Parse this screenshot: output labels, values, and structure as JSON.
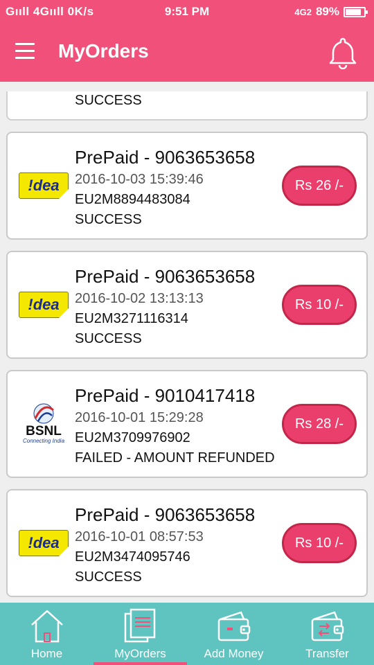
{
  "status_bar": {
    "network": "Gııll 4Gııll 0K/s",
    "time": "9:51 PM",
    "signal_label": "4G2",
    "battery": "89%"
  },
  "app_bar": {
    "title": "MyOrders",
    "menu_icon": "hamburger-icon",
    "bell_icon": "bell-icon"
  },
  "orders": {
    "partial": {
      "status": "SUCCESS"
    },
    "items": [
      {
        "operator": "idea",
        "title": "PrePaid - 9063653658",
        "datetime": "2016-10-03 15:39:46",
        "txn": "EU2M8894483084",
        "status": "SUCCESS",
        "amount": "Rs 26 /-"
      },
      {
        "operator": "idea",
        "title": "PrePaid - 9063653658",
        "datetime": "2016-10-02 13:13:13",
        "txn": "EU2M3271116314",
        "status": "SUCCESS",
        "amount": "Rs 10 /-"
      },
      {
        "operator": "bsnl",
        "title": "PrePaid - 9010417418",
        "datetime": "2016-10-01 15:29:28",
        "txn": "EU2M3709976902",
        "status": "FAILED - AMOUNT REFUNDED",
        "amount": "Rs 28 /-"
      },
      {
        "operator": "idea",
        "title": "PrePaid - 9063653658",
        "datetime": "2016-10-01 08:57:53",
        "txn": "EU2M3474095746",
        "status": "SUCCESS",
        "amount": "Rs 10 /-"
      }
    ]
  },
  "logos": {
    "idea": "!dea",
    "bsnl_name": "BSNL",
    "bsnl_tagline": "Connecting India"
  },
  "bottom_nav": {
    "active": "MyOrders",
    "items": [
      {
        "label": "Home",
        "icon": "home-icon"
      },
      {
        "label": "MyOrders",
        "icon": "orders-icon"
      },
      {
        "label": "Add Money",
        "icon": "wallet-icon"
      },
      {
        "label": "Transfer",
        "icon": "transfer-wallet-icon"
      }
    ]
  },
  "colors": {
    "primary": "#f0507a",
    "nav_bg": "#5fc3c0",
    "amount_bg": "#ea3f6c",
    "idea_yellow": "#f5e800"
  }
}
